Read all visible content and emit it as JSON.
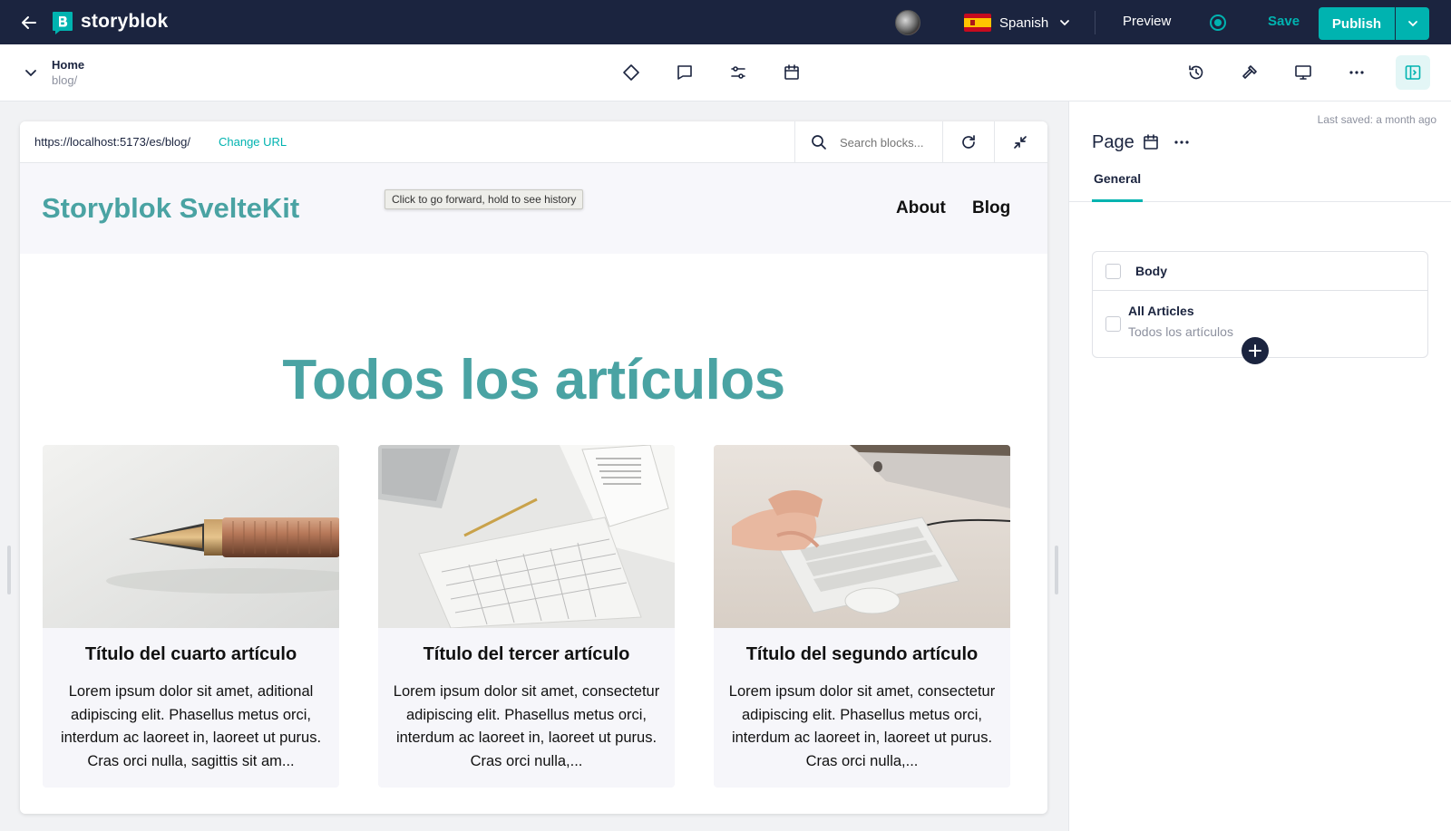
{
  "topbar": {
    "brand": "storyblok",
    "language": "Spanish",
    "preview": "Preview",
    "save": "Save",
    "publish": "Publish",
    "colors": {
      "bg": "#1b243f",
      "accent": "#00b3b0"
    }
  },
  "toolbar": {
    "story_title": "Home",
    "story_slug": "blog/",
    "center_icons": [
      "diamond-icon",
      "comment-icon",
      "sliders-icon",
      "calendar-icon"
    ],
    "right_icons": [
      "history-icon",
      "hammer-icon",
      "monitor-icon",
      "more-icon",
      "sidebar-toggle-icon"
    ]
  },
  "urlbar": {
    "url": "https://localhost:5173/es/blog/",
    "change_url": "Change URL",
    "search_placeholder": "Search blocks..."
  },
  "site": {
    "logo": "Storyblok SvelteKit",
    "nav": [
      "About",
      "Blog"
    ],
    "tooltip": "Click to go forward, hold to see history",
    "hero_title": "Todos los artículos",
    "cards": [
      {
        "title": "Título del cuarto artículo",
        "text": "Lorem ipsum dolor sit amet, aditional adipiscing elit. Phasellus metus orci, interdum ac laoreet in, laoreet ut purus. Cras orci nulla, sagittis sit am..."
      },
      {
        "title": "Título del tercer artículo",
        "text": "Lorem ipsum dolor sit amet, consectetur adipiscing elit. Phasellus metus orci, interdum ac laoreet in, laoreet ut purus. Cras orci nulla,..."
      },
      {
        "title": "Título del segundo artículo",
        "text": "Lorem ipsum dolor sit amet, consectetur adipiscing elit. Phasellus metus orci, interdum ac laoreet in, laoreet ut purus. Cras orci nulla,..."
      }
    ],
    "colors": {
      "brand": "#4aa3a3"
    }
  },
  "panel": {
    "last_saved": "Last saved: a month ago",
    "title": "Page",
    "tab": "General",
    "blocks": {
      "header": "Body",
      "item_name": "All Articles",
      "item_subtitle": "Todos los artículos"
    }
  }
}
